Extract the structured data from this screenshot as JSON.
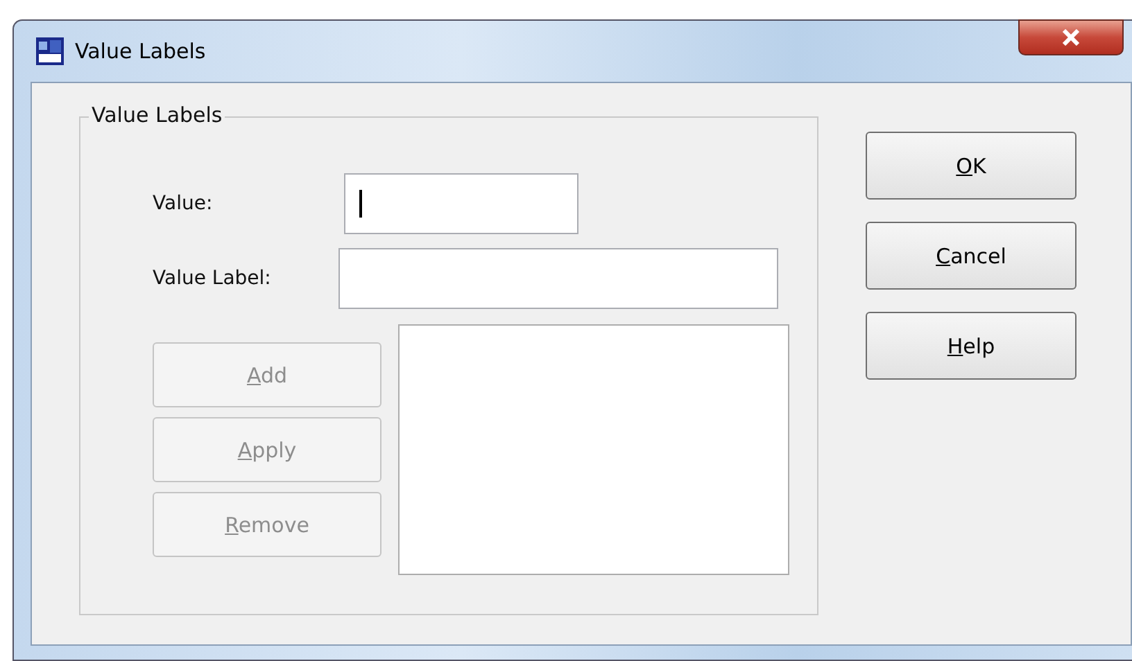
{
  "window": {
    "title": "Value Labels"
  },
  "group": {
    "title": "Value Labels",
    "fields": [
      {
        "label": "Value:",
        "focused": true,
        "kind": "short"
      },
      {
        "label": "Value Label:",
        "focused": false,
        "kind": "long"
      }
    ],
    "buttons": [
      {
        "label": "Add",
        "disabled": true,
        "mnemonic_underlined": true
      },
      {
        "label": "Apply",
        "disabled": true,
        "mnemonic_underlined": true
      },
      {
        "label": "Remove",
        "disabled": true,
        "mnemonic_underlined": true
      }
    ]
  },
  "buttons": [
    {
      "label": "OK",
      "disabled": false,
      "mnemonic_underlined": true
    },
    {
      "label": "Cancel",
      "disabled": false,
      "mnemonic_underlined": true
    },
    {
      "label": "Help",
      "disabled": false,
      "mnemonic_underlined": true
    }
  ]
}
